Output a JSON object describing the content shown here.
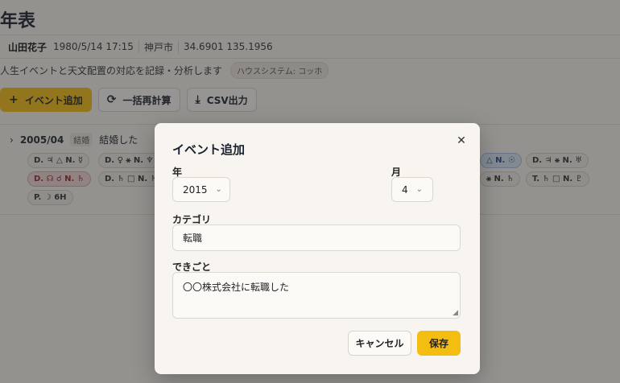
{
  "page": {
    "title": "年表",
    "person": {
      "name": "山田花子",
      "datetime": "1980/5/14 17:15",
      "place": "神戸市",
      "coords": "34.6901 135.1956"
    },
    "description": "人生イベントと天文配置の対応を記録・分析します",
    "house_system": "ハウスシステム: コッホ",
    "toolbar": {
      "add_label": "イベント追加",
      "recalc_label": "一括再計算",
      "csv_label": "CSV出力"
    }
  },
  "event": {
    "date": "2005/04",
    "category": "結婚",
    "title": "結婚した",
    "aspects_row1": [
      "D. ♃ △ N. ☿",
      "D. ♀ ⚹ N. ♆",
      "△ N. ☉",
      "D. ♃ ⚹ N. ♅"
    ],
    "aspects_row2": [
      "D. ☊ ☌ N. ♄",
      "D. ♄ □ N. ♄",
      "⚹ N. ♄",
      "T. ♄ □ N. ♇"
    ],
    "aspects_row3": [
      "P. ☽ 6H"
    ]
  },
  "modal": {
    "title": "イベント追加",
    "year_label": "年",
    "year_value": "2015",
    "month_label": "月",
    "month_value": "4",
    "category_label": "カテゴリ",
    "category_value": "転職",
    "event_label": "できごと",
    "event_value": "〇〇株式会社に転職した",
    "cancel_label": "キャンセル",
    "save_label": "保存"
  },
  "colors": {
    "accent": "#f4bd12",
    "background": "#f6f3ee",
    "overlay": "rgba(40,40,40,0.48)"
  }
}
